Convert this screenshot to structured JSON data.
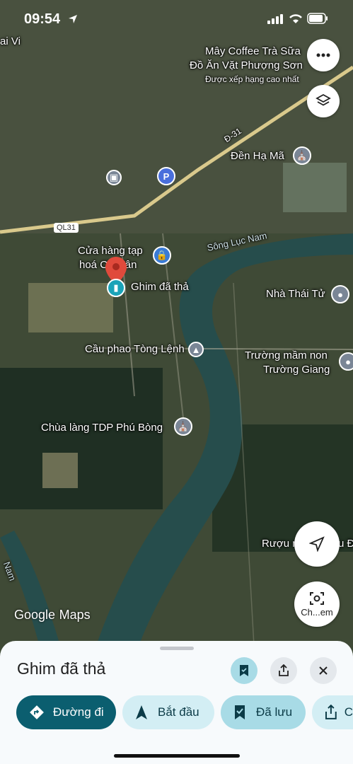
{
  "status_bar": {
    "time": "09:54"
  },
  "map": {
    "logo": "Google",
    "logo_suffix": "Maps",
    "labels": {
      "ai_vi": "ai Vi",
      "may_coffee_1": "Mây Coffee Trà Sữa",
      "may_coffee_2": "Đồ Ăn Vặt Phượng Sơn",
      "may_coffee_3": "Được xếp hạng cao nhất",
      "road_d31": "Đ-31",
      "den_ha_ma": "Đền Hạ Mã",
      "ql31": "QL31",
      "song_luc_nam": "Sông Lục Nam",
      "cua_hang_1": "Cửa hàng tạp",
      "cua_hang_2": "hoá Chi Tân",
      "ghim": "Ghim đã thả",
      "nha_thai_tu": "Nhà Thái Tử",
      "cau_phao": "Cầu phao Tòng Lệnh",
      "truong_1": "Trường mầm non",
      "truong_2": "Trường Giang",
      "chua_lang": "Chùa làng TDP Phú Bòng",
      "ruou": "Rượu n",
      "ruou_end": "u Đ",
      "nam": "Nam"
    },
    "lens_label": "Ch...em"
  },
  "sheet": {
    "title": "Ghim đã thả",
    "actions": [
      {
        "label": "Đường đi",
        "icon": "directions-icon"
      },
      {
        "label": "Bắt đầu",
        "icon": "navigation-icon"
      },
      {
        "label": "Đã lưu",
        "icon": "saved-icon"
      },
      {
        "label": "C",
        "icon": "share-icon"
      }
    ]
  },
  "colors": {
    "accent_dark": "#0b5e6f",
    "accent_light": "#d3eef4",
    "saved_bg": "#a8dbe6",
    "pin": "#e04a3c"
  }
}
